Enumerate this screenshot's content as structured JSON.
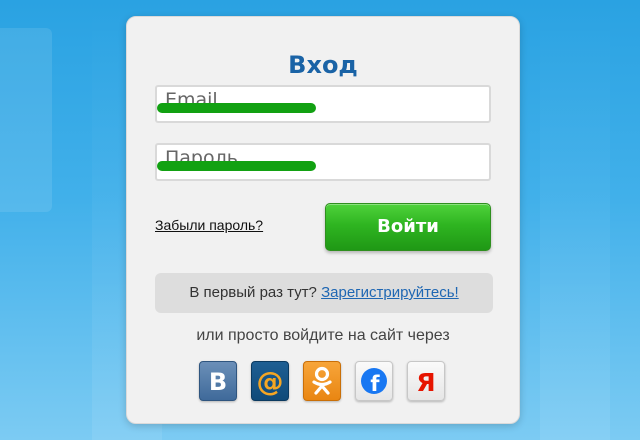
{
  "login": {
    "title": "Вход",
    "email_placeholder": "Email",
    "email_progress": 0.48,
    "password_placeholder": "Пароль",
    "password_progress": 0.48,
    "forgot_label": "Забыли пароль?",
    "submit_label": "Войти"
  },
  "register": {
    "prompt": "В первый раз тут? ",
    "link_label": "Зарегистрируйтесь!"
  },
  "social": {
    "caption": "или просто войдите на сайт через",
    "providers": [
      {
        "name": "vk",
        "icon": "vk-icon",
        "color": "#4a6f9c"
      },
      {
        "name": "mail",
        "icon": "mail-ru-icon",
        "color": "#f5a623"
      },
      {
        "name": "ok",
        "icon": "odnoklassniki-icon",
        "color": "#ee8208"
      },
      {
        "name": "facebook",
        "icon": "facebook-icon",
        "color": "#1877f2"
      },
      {
        "name": "yandex",
        "icon": "yandex-icon",
        "color": "#e61400"
      }
    ]
  },
  "colors": {
    "accent": "#1a63a6",
    "progress": "#12a112",
    "button": "#2fb521"
  }
}
